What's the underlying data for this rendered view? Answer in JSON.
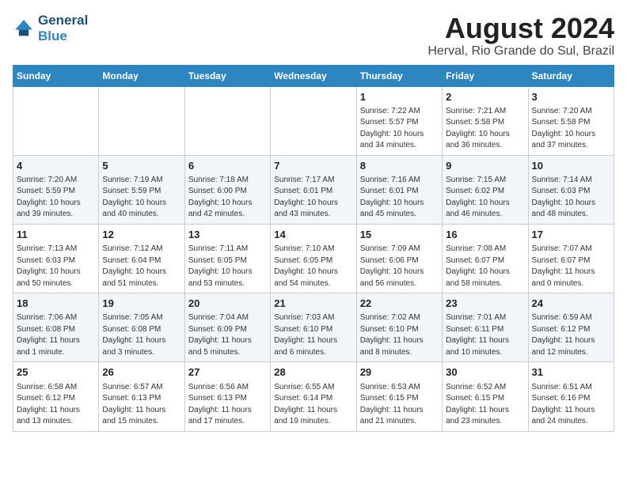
{
  "header": {
    "logo_line1": "General",
    "logo_line2": "Blue",
    "title": "August 2024",
    "subtitle": "Herval, Rio Grande do Sul, Brazil"
  },
  "calendar": {
    "days_of_week": [
      "Sunday",
      "Monday",
      "Tuesday",
      "Wednesday",
      "Thursday",
      "Friday",
      "Saturday"
    ],
    "weeks": [
      [
        {
          "day": "",
          "info": ""
        },
        {
          "day": "",
          "info": ""
        },
        {
          "day": "",
          "info": ""
        },
        {
          "day": "",
          "info": ""
        },
        {
          "day": "1",
          "info": "Sunrise: 7:22 AM\nSunset: 5:57 PM\nDaylight: 10 hours\nand 34 minutes."
        },
        {
          "day": "2",
          "info": "Sunrise: 7:21 AM\nSunset: 5:58 PM\nDaylight: 10 hours\nand 36 minutes."
        },
        {
          "day": "3",
          "info": "Sunrise: 7:20 AM\nSunset: 5:58 PM\nDaylight: 10 hours\nand 37 minutes."
        }
      ],
      [
        {
          "day": "4",
          "info": "Sunrise: 7:20 AM\nSunset: 5:59 PM\nDaylight: 10 hours\nand 39 minutes."
        },
        {
          "day": "5",
          "info": "Sunrise: 7:19 AM\nSunset: 5:59 PM\nDaylight: 10 hours\nand 40 minutes."
        },
        {
          "day": "6",
          "info": "Sunrise: 7:18 AM\nSunset: 6:00 PM\nDaylight: 10 hours\nand 42 minutes."
        },
        {
          "day": "7",
          "info": "Sunrise: 7:17 AM\nSunset: 6:01 PM\nDaylight: 10 hours\nand 43 minutes."
        },
        {
          "day": "8",
          "info": "Sunrise: 7:16 AM\nSunset: 6:01 PM\nDaylight: 10 hours\nand 45 minutes."
        },
        {
          "day": "9",
          "info": "Sunrise: 7:15 AM\nSunset: 6:02 PM\nDaylight: 10 hours\nand 46 minutes."
        },
        {
          "day": "10",
          "info": "Sunrise: 7:14 AM\nSunset: 6:03 PM\nDaylight: 10 hours\nand 48 minutes."
        }
      ],
      [
        {
          "day": "11",
          "info": "Sunrise: 7:13 AM\nSunset: 6:03 PM\nDaylight: 10 hours\nand 50 minutes."
        },
        {
          "day": "12",
          "info": "Sunrise: 7:12 AM\nSunset: 6:04 PM\nDaylight: 10 hours\nand 51 minutes."
        },
        {
          "day": "13",
          "info": "Sunrise: 7:11 AM\nSunset: 6:05 PM\nDaylight: 10 hours\nand 53 minutes."
        },
        {
          "day": "14",
          "info": "Sunrise: 7:10 AM\nSunset: 6:05 PM\nDaylight: 10 hours\nand 54 minutes."
        },
        {
          "day": "15",
          "info": "Sunrise: 7:09 AM\nSunset: 6:06 PM\nDaylight: 10 hours\nand 56 minutes."
        },
        {
          "day": "16",
          "info": "Sunrise: 7:08 AM\nSunset: 6:07 PM\nDaylight: 10 hours\nand 58 minutes."
        },
        {
          "day": "17",
          "info": "Sunrise: 7:07 AM\nSunset: 6:07 PM\nDaylight: 11 hours\nand 0 minutes."
        }
      ],
      [
        {
          "day": "18",
          "info": "Sunrise: 7:06 AM\nSunset: 6:08 PM\nDaylight: 11 hours\nand 1 minute."
        },
        {
          "day": "19",
          "info": "Sunrise: 7:05 AM\nSunset: 6:08 PM\nDaylight: 11 hours\nand 3 minutes."
        },
        {
          "day": "20",
          "info": "Sunrise: 7:04 AM\nSunset: 6:09 PM\nDaylight: 11 hours\nand 5 minutes."
        },
        {
          "day": "21",
          "info": "Sunrise: 7:03 AM\nSunset: 6:10 PM\nDaylight: 11 hours\nand 6 minutes."
        },
        {
          "day": "22",
          "info": "Sunrise: 7:02 AM\nSunset: 6:10 PM\nDaylight: 11 hours\nand 8 minutes."
        },
        {
          "day": "23",
          "info": "Sunrise: 7:01 AM\nSunset: 6:11 PM\nDaylight: 11 hours\nand 10 minutes."
        },
        {
          "day": "24",
          "info": "Sunrise: 6:59 AM\nSunset: 6:12 PM\nDaylight: 11 hours\nand 12 minutes."
        }
      ],
      [
        {
          "day": "25",
          "info": "Sunrise: 6:58 AM\nSunset: 6:12 PM\nDaylight: 11 hours\nand 13 minutes."
        },
        {
          "day": "26",
          "info": "Sunrise: 6:57 AM\nSunset: 6:13 PM\nDaylight: 11 hours\nand 15 minutes."
        },
        {
          "day": "27",
          "info": "Sunrise: 6:56 AM\nSunset: 6:13 PM\nDaylight: 11 hours\nand 17 minutes."
        },
        {
          "day": "28",
          "info": "Sunrise: 6:55 AM\nSunset: 6:14 PM\nDaylight: 11 hours\nand 19 minutes."
        },
        {
          "day": "29",
          "info": "Sunrise: 6:53 AM\nSunset: 6:15 PM\nDaylight: 11 hours\nand 21 minutes."
        },
        {
          "day": "30",
          "info": "Sunrise: 6:52 AM\nSunset: 6:15 PM\nDaylight: 11 hours\nand 23 minutes."
        },
        {
          "day": "31",
          "info": "Sunrise: 6:51 AM\nSunset: 6:16 PM\nDaylight: 11 hours\nand 24 minutes."
        }
      ]
    ]
  }
}
